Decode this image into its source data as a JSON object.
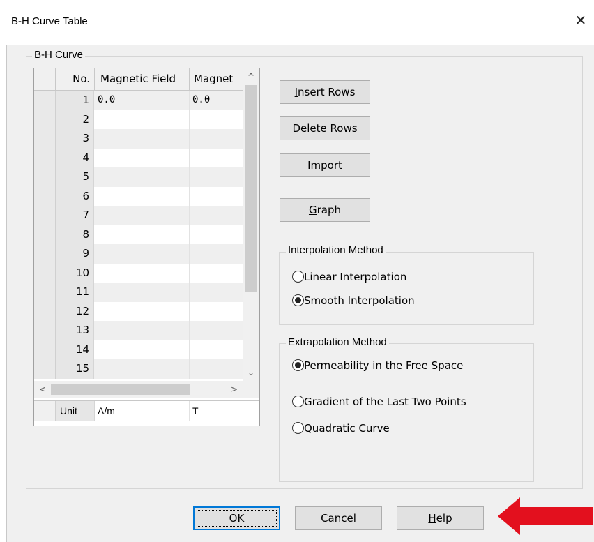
{
  "window": {
    "title": "B-H Curve Table",
    "close_symbol": "✕"
  },
  "bh_group": {
    "legend": "B-H Curve"
  },
  "grid": {
    "columns": [
      "No.",
      "Magnetic Field",
      "Magnet"
    ],
    "rows": [
      {
        "no": "1",
        "field": "0.0",
        "flux": "0.0"
      },
      {
        "no": "2",
        "field": "",
        "flux": ""
      },
      {
        "no": "3",
        "field": "",
        "flux": ""
      },
      {
        "no": "4",
        "field": "",
        "flux": ""
      },
      {
        "no": "5",
        "field": "",
        "flux": ""
      },
      {
        "no": "6",
        "field": "",
        "flux": ""
      },
      {
        "no": "7",
        "field": "",
        "flux": ""
      },
      {
        "no": "8",
        "field": "",
        "flux": ""
      },
      {
        "no": "9",
        "field": "",
        "flux": ""
      },
      {
        "no": "10",
        "field": "",
        "flux": ""
      },
      {
        "no": "11",
        "field": "",
        "flux": ""
      },
      {
        "no": "12",
        "field": "",
        "flux": ""
      },
      {
        "no": "13",
        "field": "",
        "flux": ""
      },
      {
        "no": "14",
        "field": "",
        "flux": ""
      },
      {
        "no": "15",
        "field": "",
        "flux": ""
      }
    ],
    "unit_row": {
      "label": "Unit",
      "field_unit": "A/m",
      "flux_unit": "T"
    },
    "scroll_up": "^",
    "scroll_down": "⌄",
    "scroll_left": "<",
    "scroll_right": ">"
  },
  "buttons": {
    "insert_rows": {
      "mnemonic": "I",
      "rest": "nsert Rows"
    },
    "delete_rows": {
      "mnemonic": "D",
      "rest": "elete Rows"
    },
    "import": {
      "before": "I",
      "mnemonic": "m",
      "rest": "port"
    },
    "graph": {
      "mnemonic": "G",
      "rest": "raph"
    }
  },
  "interpolation": {
    "legend": "Interpolation Method",
    "options": [
      {
        "label": "Linear Interpolation",
        "checked": false
      },
      {
        "label": "Smooth Interpolation",
        "checked": true
      }
    ]
  },
  "extrapolation": {
    "legend": "Extrapolation Method",
    "options": [
      {
        "label": "Permeability in the Free Space",
        "checked": true
      },
      {
        "label": "Gradient of the Last Two Points",
        "checked": false
      },
      {
        "label": "Quadratic Curve",
        "checked": false
      }
    ]
  },
  "dialog_buttons": {
    "ok": "OK",
    "cancel": "Cancel",
    "help": {
      "mnemonic": "H",
      "rest": "elp"
    }
  },
  "annotation": {
    "arrow_color": "#e3101e",
    "points_to": "help-button"
  }
}
